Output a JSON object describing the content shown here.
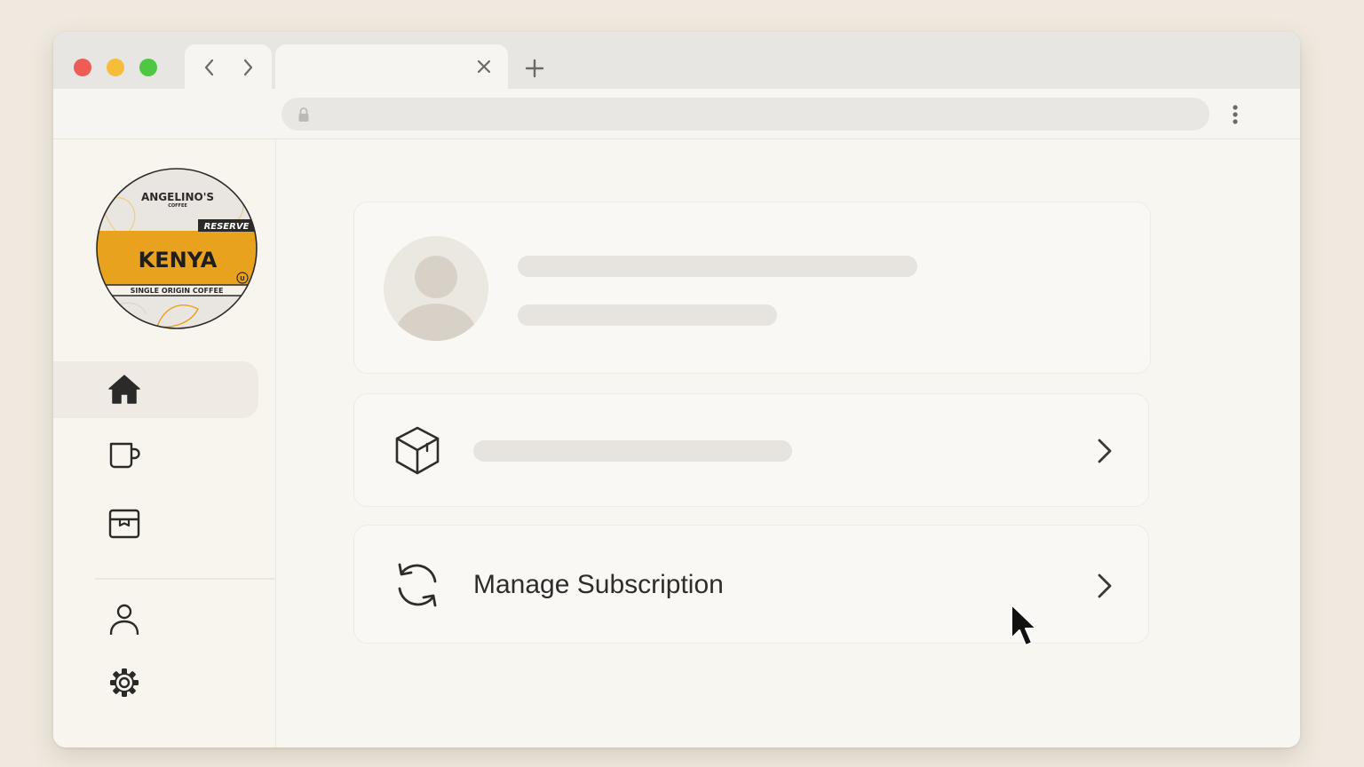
{
  "browser": {
    "tab_title": "",
    "url": "",
    "traffic_lights": {
      "close": "#ee5d54",
      "minimize": "#f5bd3a",
      "zoom": "#4ec843"
    }
  },
  "logo": {
    "brand": "ANGELINO'S",
    "brand_sub": "COFFEE",
    "badge": "RESERVE",
    "name": "KENYA",
    "tagline": "SINGLE ORIGIN COFFEE",
    "mark": "U"
  },
  "sidebar": {
    "items": [
      {
        "icon": "home-icon",
        "active": true
      },
      {
        "icon": "coffee-cup-icon",
        "active": false
      },
      {
        "icon": "box-icon",
        "active": false
      },
      {
        "icon": "user-icon",
        "active": false
      },
      {
        "icon": "settings-gear-icon",
        "active": false
      }
    ]
  },
  "main": {
    "profile": {
      "name": "",
      "subtitle": ""
    },
    "rows": [
      {
        "icon": "package-icon",
        "label": ""
      },
      {
        "icon": "refresh-icon",
        "label": "Manage Subscription"
      }
    ]
  },
  "colors": {
    "background": "#efe9df",
    "window": "#f7f4ee",
    "accent": "#e8a21d",
    "text": "#2f2d2b"
  }
}
